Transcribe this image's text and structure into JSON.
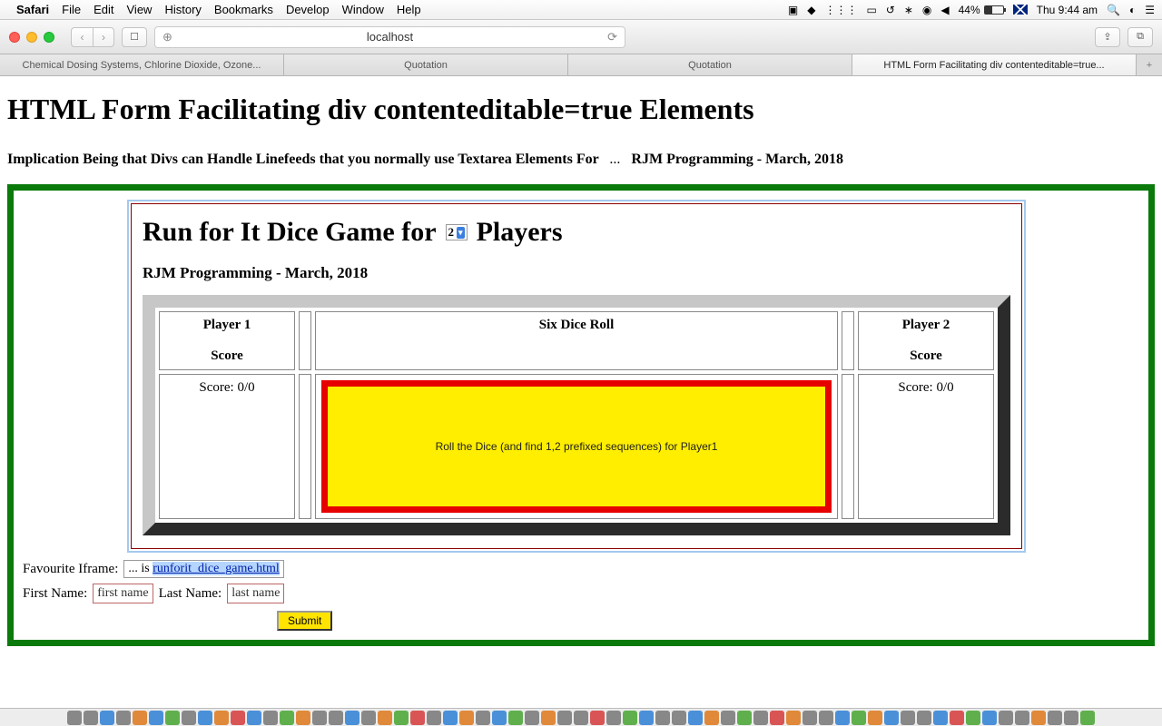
{
  "menubar": {
    "app": "Safari",
    "items": [
      "File",
      "Edit",
      "View",
      "History",
      "Bookmarks",
      "Develop",
      "Window",
      "Help"
    ],
    "battery": "44%",
    "clock": "Thu 9:44 am"
  },
  "toolbar": {
    "url": "localhost"
  },
  "tabs": [
    "Chemical Dosing Systems, Chlorine Dioxide, Ozone...",
    "Quotation",
    "Quotation",
    "HTML Form Facilitating div contenteditable=true..."
  ],
  "page": {
    "h1": "HTML Form Facilitating div contenteditable=true Elements",
    "sub_main": "Implication Being that Divs can Handle Linefeeds that you normally use Textarea Elements For",
    "sub_dots": "...",
    "sub_credit": "RJM Programming - March, 2018"
  },
  "game": {
    "title_pre": "Run for It Dice Game for",
    "player_count": "2",
    "title_post": "Players",
    "credit": "RJM Programming - March, 2018",
    "col1_header": "Player 1",
    "score_header": "Score",
    "col2_header": "Six Dice Roll",
    "col3_header": "Player 2",
    "p1_score": "Score: 0/0",
    "p2_score": "Score: 0/0",
    "roll_text": "Roll the Dice (and find 1,2 prefixed sequences) for Player1"
  },
  "form": {
    "fav_label": "Favourite Iframe:",
    "fav_prefix": "... is ",
    "fav_link": "runforit_dice_game.html",
    "first_label": "First Name:",
    "first_ph": "first name",
    "last_label": "Last Name:",
    "last_ph": "last name",
    "submit": "Submit"
  }
}
